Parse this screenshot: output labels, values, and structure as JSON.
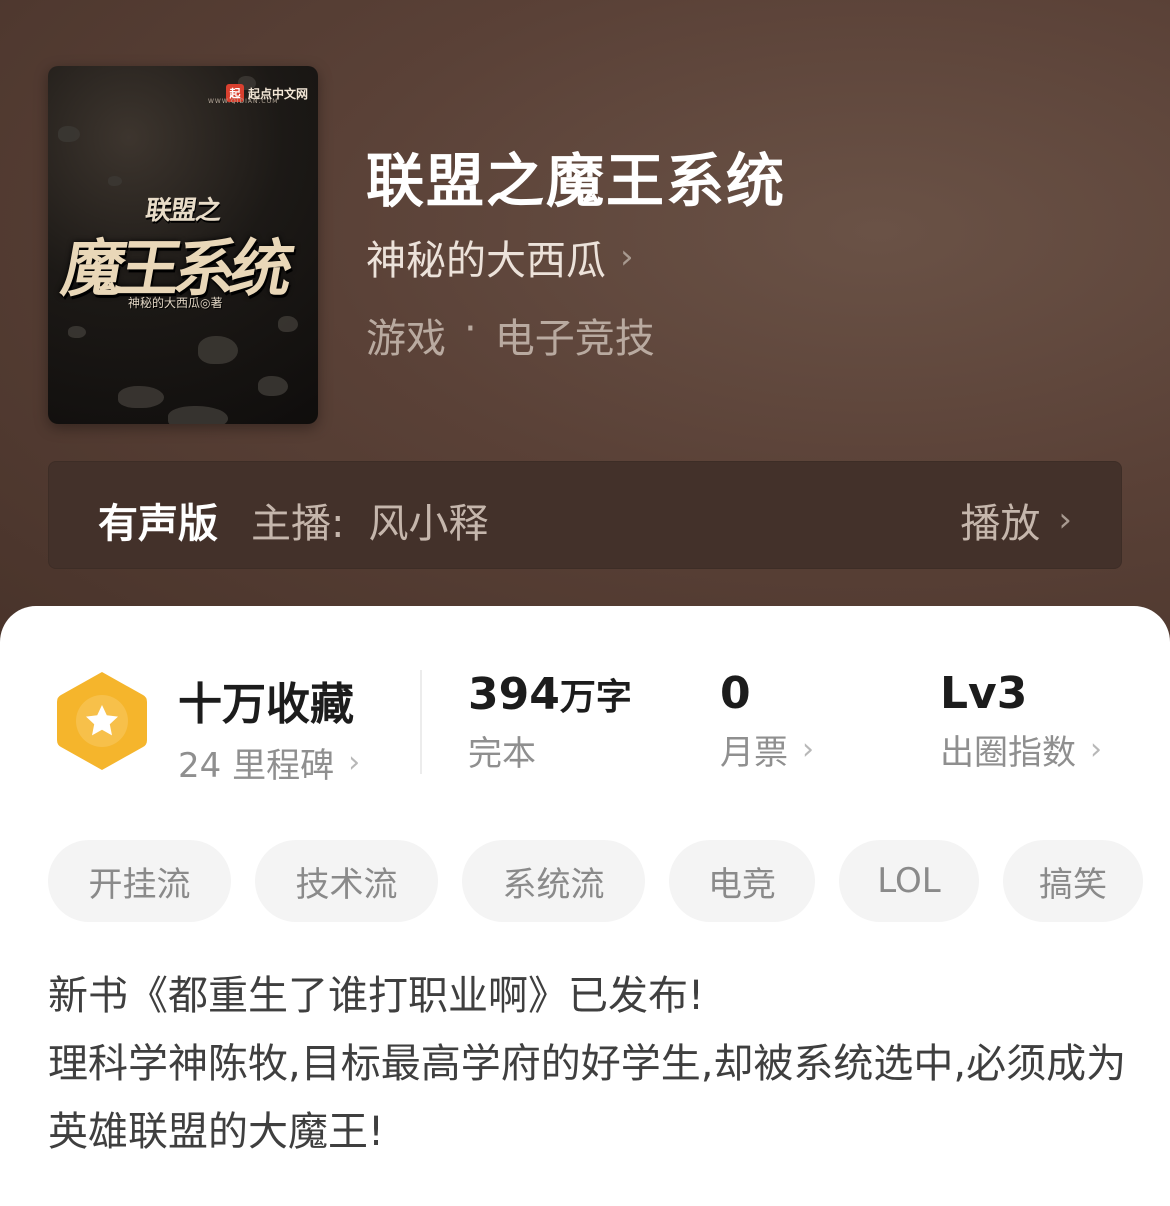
{
  "cover": {
    "brand": "起点中文网",
    "brand_logo_char": "起",
    "brand_sub": "WWW.QIDIAN.COM",
    "title_line1": "联盟之",
    "title_line2": "魔王系统",
    "author": "神秘的大西瓜◎著"
  },
  "book": {
    "title": "联盟之魔王系统",
    "author": "神秘的大西瓜",
    "genre_main": "游戏",
    "genre_sep": "·",
    "genre_sub": "电子竞技"
  },
  "audio": {
    "label": "有声版",
    "host_label": "主播:",
    "host_name": "风小释",
    "play_label": "播放"
  },
  "stats": {
    "collection": "十万收藏",
    "milestones": "24 里程碑",
    "word_count": "394",
    "word_unit": "万字",
    "status": "完本",
    "monthly_votes": "0",
    "monthly_votes_label": "月票",
    "level": "Lv3",
    "level_label": "出圈指数"
  },
  "tags": [
    "开挂流",
    "技术流",
    "系统流",
    "电竞",
    "LOL",
    "搞笑"
  ],
  "description": {
    "line1": "新书《都重生了谁打职业啊》已发布!",
    "line2": "理科学神陈牧,目标最高学府的好学生,却被系统选中,必须成为英雄联盟的大魔王!"
  },
  "colors": {
    "hero_bg": "#553d33",
    "badge": "#f5b52c",
    "text_dark": "#1c1c1c",
    "text_gray": "#8f8f8f"
  }
}
